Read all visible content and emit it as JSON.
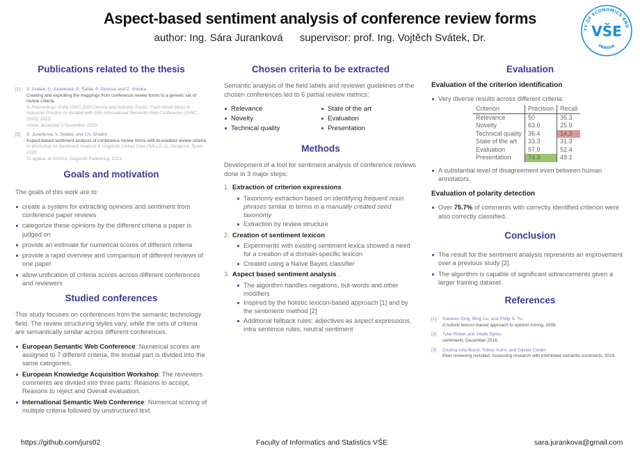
{
  "header": {
    "title": "Aspect-based sentiment analysis of conference review forms",
    "author": "author: Ing. Sára Juranková",
    "supervisor": "supervisor: prof. Ing. Vojtěch Svátek, Dr."
  },
  "logo": {
    "ring_text": "UNIVERSITY OF ECONOMICS AND BUSINESS",
    "bottom_text": "PRAGUE",
    "mark": "VŠE",
    "color": "#1a8fd8"
  },
  "publications": {
    "heading": "Publications related to the thesis",
    "items": [
      {
        "num": "[1]",
        "authors": "V. Svátek, S. Juranková, R. Šalda, P. Strossa, and Z. Vondra.",
        "title": "Creating and exploiting the mappings from conference review forms to a generic set of review criteria.",
        "venue": "In Proceedings of the ISWC 2020 Demos and Industry Tracks: From Novel Ideas to Industrial Practice co-located with 19th International Semantic Web Conference (ISWC 2020), 2020.",
        "note": "online, accessed 2-November-2020."
      },
      {
        "num": "[2]",
        "authors": "S. Juranková, V. Svátek, and Ch. Ghidini.",
        "title": "Aspect-based sentiment analysis of conference review forms with ld-enabled review criteria.",
        "venue": "In Workshop on Sentiment Analysis & Linguistic Linked Data (SALLD-1), Zaragoza, Spain, 2020.",
        "note": "To appear at OASIcs, Dagstuhl Publishing, 2021."
      }
    ]
  },
  "goals": {
    "heading": "Goals and motivation",
    "intro": "The goals of this work are to:",
    "items": [
      "create a system for extracting opinions and sentiment from conference paper reviews",
      "categorize these opinions by the different criteria a paper is judged on",
      "provide an estimate for numerical scores of different criteria",
      "provide a rapid overview and comparison of different reviews of one paper",
      "allow unification of criteria scores across different conferences and reviewers"
    ]
  },
  "conferences": {
    "heading": "Studied conferences",
    "intro": "This study focuses on conferences from the semantic technology field. The review structuring styles vary, while the sets of criteria are semantically similar across different conferences.",
    "items": [
      {
        "name": "European Semantic Web Conference",
        "desc": ": Numerical scores are assigned to 7 different criteria, the textual part is divided into the same categories."
      },
      {
        "name": "European Knowledge Acquisition Workshop",
        "desc": ": The reviewers comments are divided into three parts: Reasons to accept, Reasons to reject and Overall evaluation."
      },
      {
        "name": "International Semantic Web Conference",
        "desc": ": Numerical scoring of multiple criteria followed by unstructured text."
      }
    ]
  },
  "criteria": {
    "heading": "Chosen criteria to be extracted",
    "intro": "Semantic analysis of the field labels and reviewer guidelines of the chosen conferences led to 6 partial review metrics:",
    "left": [
      "Relevance",
      "Novelty",
      "Technical quality"
    ],
    "right": [
      "State of the art",
      "Evaluation",
      "Presentation"
    ]
  },
  "methods": {
    "heading": "Methods",
    "intro": "Development of a tool for sentiment analysis of conference reviews done in 3 major steps:",
    "steps": [
      {
        "num": "1.",
        "title": "Extraction of criterion expressions",
        "sub1_a": "Taxonomy extraction based on identifying ",
        "sub1_b": "frequent noun phrases",
        "sub1_c": " similar to terms in a ",
        "sub1_d": "manually created seed taxonomy",
        "sub2": "Extraction by review structure"
      },
      {
        "num": "2.",
        "title": "Creation of sentiment lexicon",
        "items": [
          "Experiments with existing sentiment lexica showed a need for a creation of a domain-specific lexicon",
          "Created using a Naïve Bayes classifier"
        ]
      },
      {
        "num": "3.",
        "title": "Aspect based sentiment analysis",
        "title_suffix": " .",
        "items": [
          "The algorithm handles negations, but-words and other modifiers",
          "Inspired by the holistic lexicon-based approach [1] and by the sentimentr method [2]",
          "Additional fallback rules: adjectives as aspect expressions, intra sentence rules, neutral sentiment"
        ]
      }
    ]
  },
  "evaluation": {
    "heading": "Evaluation",
    "sub1": "Evaluation of the criterion identification",
    "bullet1": "Very diverse results across different criteria:",
    "table": {
      "headers": [
        "Criterion",
        "Precision",
        "Recall"
      ],
      "rows": [
        [
          "Relevance",
          "50",
          "35.3"
        ],
        [
          "Novelty",
          "63.6",
          "25.9"
        ],
        [
          "Technical quality",
          "36.4",
          "14.3"
        ],
        [
          "State of the art",
          "33.3",
          "31.3"
        ],
        [
          "Evaluation",
          "57.9",
          "52.4"
        ],
        [
          "Presentation",
          "74.3",
          "49.1"
        ]
      ],
      "highlight_low": "#d69a9a",
      "highlight_high": "#9ac46e"
    },
    "bullet2": "A substantial level of disagreement even between human annotators.",
    "sub2": "Evaluation of polarity detection",
    "polarity_pre": "Over ",
    "polarity_value": "75.7%",
    "polarity_post": " of comments with correctly identified criterion were also correctly classified."
  },
  "conclusion": {
    "heading": "Conclusion",
    "items": [
      "The result for the sentiment analysis represents an improvement over a previous study [3].",
      "The algorithm is capable of significant advancements given a larger training dataset."
    ]
  },
  "references": {
    "heading": "References",
    "items": [
      {
        "num": "[1]",
        "authors": "Xiaowen Ding, Bing Liu, and Philip S. Yu.",
        "title": "A holistic lexicon-based approach to opinion mining, 2008."
      },
      {
        "num": "[2]",
        "authors": "Tyler Rinker and Vitalie Spinu.",
        "title": "sentimentr, December 2016."
      },
      {
        "num": "[3]",
        "authors": "Cristina-Iulia Bucur, Tobias Kuhn, and Davide Ceolin.",
        "title": "Peer reviewing revisited: Assessing research with interlinked semantic comments, 2019."
      }
    ]
  },
  "footer": {
    "github": "https://github.com/jurs02",
    "faculty": "Faculty of Informatics and Statistics VŠE",
    "email": "sara.jurankova@gmail.com"
  }
}
